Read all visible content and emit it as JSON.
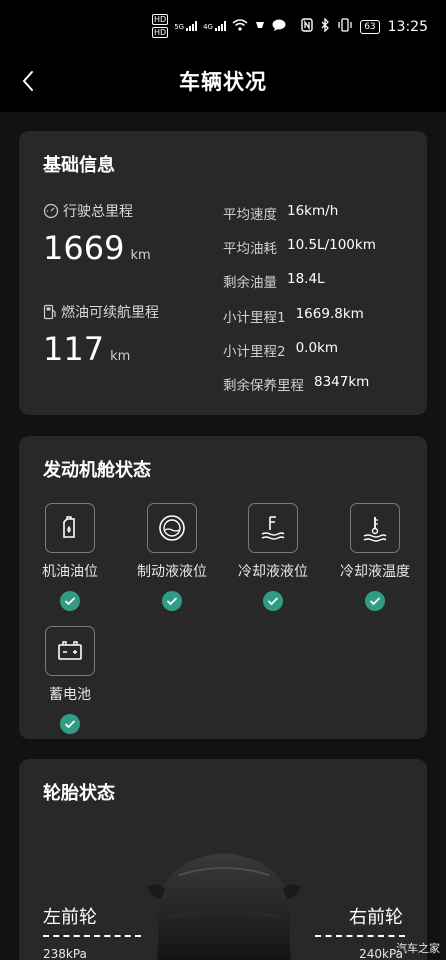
{
  "status_bar": {
    "chip1": "HD",
    "chip2": "HD",
    "net1": "5G",
    "net2": "4G",
    "battery": "63",
    "time": "13:25",
    "icons": [
      "signal-icon",
      "wifi-icon",
      "message-icon",
      "nfc-icon",
      "bluetooth-icon",
      "vibrate-icon",
      "battery-icon"
    ]
  },
  "header": {
    "title": "车辆状况",
    "back_icon": "chevron-left-icon"
  },
  "basic_info": {
    "title": "基础信息",
    "total_mileage": {
      "label": "行驶总里程",
      "value": "1669",
      "unit": "km",
      "icon": "odometer-icon"
    },
    "range": {
      "label": "燃油可续航里程",
      "value": "117",
      "unit": "km",
      "icon": "fuel-pump-icon"
    },
    "details": [
      {
        "key": "平均速度",
        "value": "16km/h"
      },
      {
        "key": "平均油耗",
        "value": "10.5L/100km"
      },
      {
        "key": "剩余油量",
        "value": "18.4L"
      },
      {
        "key": "小计里程1",
        "value": "1669.8km"
      },
      {
        "key": "小计里程2",
        "value": "0.0km"
      },
      {
        "key": "剩余保养里程",
        "value": "8347km"
      }
    ]
  },
  "engine_bay": {
    "title": "发动机舱状态",
    "items": [
      {
        "label": "机油油位",
        "icon": "oil-level-icon",
        "status": "ok"
      },
      {
        "label": "制动液液位",
        "icon": "brake-fluid-icon",
        "status": "ok"
      },
      {
        "label": "冷却液液位",
        "icon": "coolant-level-icon",
        "status": "ok"
      },
      {
        "label": "冷却液温度",
        "icon": "coolant-temperature-icon",
        "status": "ok"
      },
      {
        "label": "蓄电池",
        "icon": "battery-icon",
        "status": "ok"
      }
    ],
    "check_color": "#2f9c84"
  },
  "tires": {
    "title": "轮胎状态",
    "front_left": {
      "label": "左前轮",
      "pressure": "238kPa"
    },
    "front_right": {
      "label": "右前轮",
      "pressure": "240kPa"
    }
  },
  "watermark": "汽车之家",
  "colors": {
    "background": "#121212",
    "card": "#282828",
    "accent": "#2f9c84"
  }
}
